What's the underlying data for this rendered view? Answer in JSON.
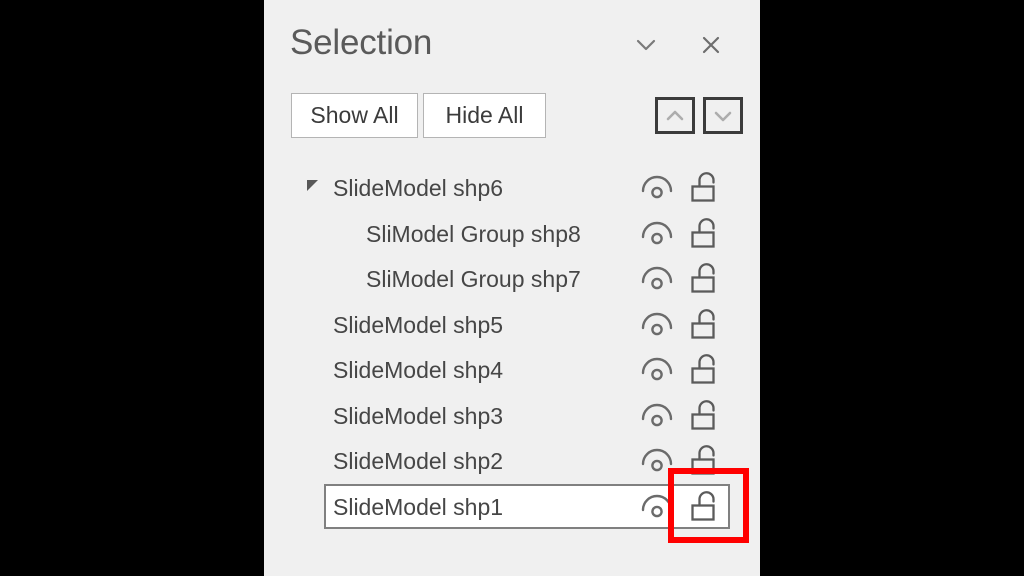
{
  "pane": {
    "title": "Selection",
    "header_buttons": [
      {
        "name": "collapse-pane-button",
        "icon": "chevron-down-icon",
        "label": ""
      },
      {
        "name": "close-pane-button",
        "icon": "close-icon",
        "label": ""
      }
    ],
    "toolbar": {
      "show_all_label": "Show All",
      "hide_all_label": "Hide All",
      "move_up_icon": "chevron-up-icon",
      "move_down_icon": "chevron-down-icon"
    }
  },
  "shapes": [
    {
      "label": "SlideModel shp6",
      "level": 0,
      "expanded": true,
      "has_toggle": true,
      "selected": false,
      "eye_icon": "eye-visible-icon",
      "lock_icon": "lock-open-icon"
    },
    {
      "label": "SliModel Group shp8",
      "level": 1,
      "expanded": false,
      "has_toggle": false,
      "selected": false,
      "eye_icon": "eye-visible-icon",
      "lock_icon": "lock-open-icon"
    },
    {
      "label": "SliModel Group shp7",
      "level": 1,
      "expanded": false,
      "has_toggle": false,
      "selected": false,
      "eye_icon": "eye-visible-icon",
      "lock_icon": "lock-open-icon"
    },
    {
      "label": "SlideModel shp5",
      "level": 0,
      "expanded": false,
      "has_toggle": false,
      "selected": false,
      "eye_icon": "eye-visible-icon",
      "lock_icon": "lock-open-icon"
    },
    {
      "label": "SlideModel shp4",
      "level": 0,
      "expanded": false,
      "has_toggle": false,
      "selected": false,
      "eye_icon": "eye-visible-icon",
      "lock_icon": "lock-open-icon"
    },
    {
      "label": "SlideModel shp3",
      "level": 0,
      "expanded": false,
      "has_toggle": false,
      "selected": false,
      "eye_icon": "eye-visible-icon",
      "lock_icon": "lock-open-icon"
    },
    {
      "label": "SlideModel shp2",
      "level": 0,
      "expanded": false,
      "has_toggle": false,
      "selected": false,
      "eye_icon": "eye-visible-icon",
      "lock_icon": "lock-open-icon"
    },
    {
      "label": "SlideModel shp1",
      "level": 0,
      "expanded": false,
      "has_toggle": false,
      "selected": true,
      "eye_icon": "eye-visible-icon",
      "lock_icon": "lock-open-icon"
    }
  ],
  "annotation": {
    "name": "lock-highlight-rect",
    "color": "#ff0000",
    "target": "lock-open-icon of SlideModel shp1"
  },
  "colors": {
    "pane_background": "#f0f0f0",
    "letterbox": "#000000",
    "text": "#464646",
    "title_text": "#5a5a5a",
    "button_border": "#b4b4b4",
    "selection_border": "#808080",
    "highlight": "#ff0000"
  }
}
